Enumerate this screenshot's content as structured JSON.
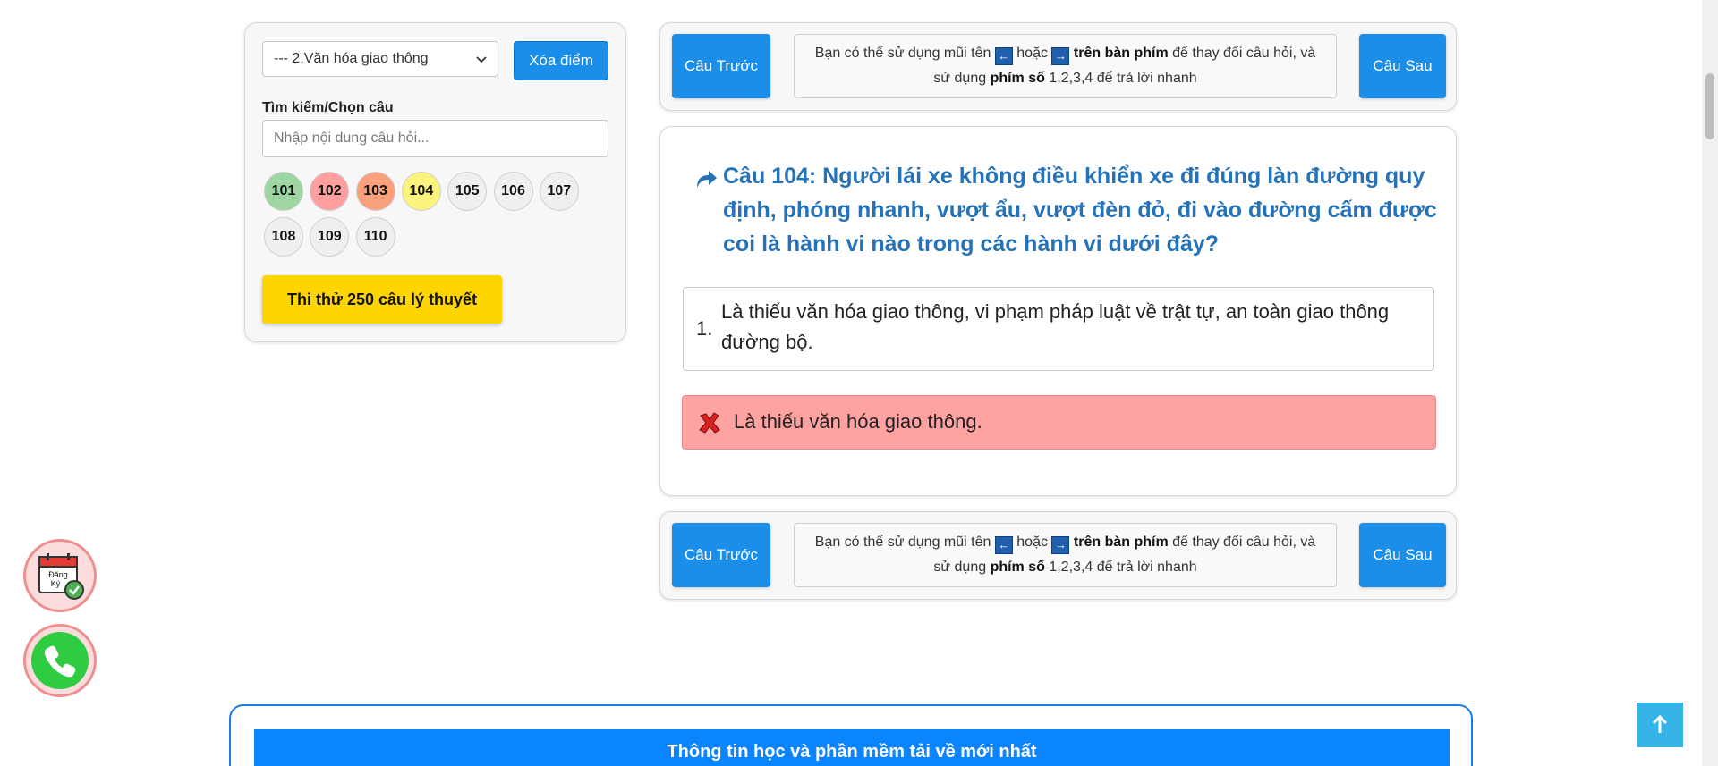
{
  "sidebar": {
    "topic_select": "--- 2.Văn hóa giao thông",
    "clear_button": "Xóa điểm",
    "search_label": "Tìm kiếm/Chọn câu",
    "search_placeholder": "Nhập nội dung câu hỏi...",
    "questions": [
      {
        "label": "101",
        "status": "correct",
        "color": "#9dd6a3"
      },
      {
        "label": "102",
        "status": "wrong",
        "color": "#ff9f9f"
      },
      {
        "label": "103",
        "status": "wrong-orange",
        "color": "#f9a07c"
      },
      {
        "label": "104",
        "status": "current",
        "color": "#fbf47c"
      },
      {
        "label": "105",
        "status": "unanswered",
        "color": "#efefef"
      },
      {
        "label": "106",
        "status": "unanswered",
        "color": "#efefef"
      },
      {
        "label": "107",
        "status": "unanswered",
        "color": "#efefef"
      },
      {
        "label": "108",
        "status": "unanswered",
        "color": "#efefef"
      },
      {
        "label": "109",
        "status": "unanswered",
        "color": "#efefef"
      },
      {
        "label": "110",
        "status": "unanswered",
        "color": "#efefef"
      }
    ],
    "trial_button": "Thi thử 250 câu lý thuyết"
  },
  "nav": {
    "prev_label": "Câu Trước",
    "next_label": "Câu Sau",
    "hint_part1": "Bạn có thể sử dụng mũi tên",
    "left_key": "←",
    "hint_or": "hoặc",
    "right_key": "→",
    "hint_bold1": "trên bàn phím",
    "hint_part2": "để thay đổi câu hỏi, và",
    "hint_part3": "sử dụng",
    "hint_bold2": "phím số",
    "hint_part4": "1,2,3,4 để trả lời nhanh"
  },
  "question": {
    "title": "Câu 104: Người lái xe không điều khiển xe đi đúng làn đường quy định, phóng nhanh, vượt ẩu, vượt đèn đỏ, đi vào đường cấm được coi là hành vi nào trong các hành vi dưới đây?",
    "answers": [
      {
        "number": "1.",
        "text": "Là thiếu văn hóa giao thông, vi phạm pháp luật về trật tự, an toàn giao thông đường bộ."
      }
    ],
    "wrong_answer": "Là thiếu văn hóa giao thông."
  },
  "floating": {
    "register_label_1": "Đăng",
    "register_label_2": "Ký"
  },
  "footer": {
    "info_title": "Thông tin học và phần mềm tải về mới nhất"
  },
  "colors": {
    "primary_blue": "#1a8ee8",
    "title_blue": "#2572b8",
    "trial_yellow": "#ffd500",
    "wrong_bg": "#ffa2a2",
    "info_blue": "#0a84ff"
  }
}
